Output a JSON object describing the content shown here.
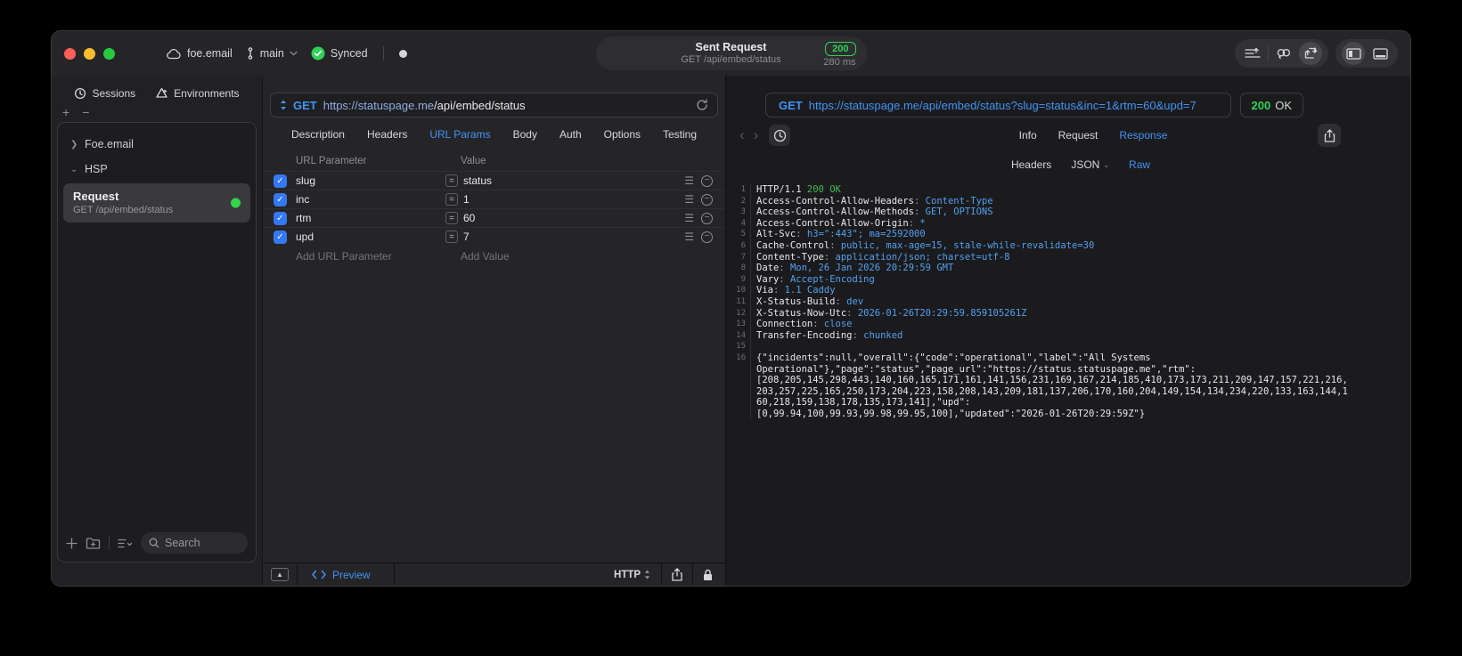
{
  "colors": {
    "accent_blue": "#4293f5",
    "status_green": "#30d158",
    "header_value_blue": "#52a0f0"
  },
  "titlebar": {
    "project": "foe.email",
    "branch": "main",
    "sync_label": "Synced",
    "center": {
      "title": "Sent Request",
      "subtitle": "GET /api/embed/status",
      "status_code": "200",
      "duration": "280 ms"
    }
  },
  "sidebar": {
    "tabs": [
      {
        "label": "Sessions"
      },
      {
        "label": "Environments"
      }
    ],
    "groups": [
      {
        "label": "Foe.email"
      },
      {
        "label": "HSP"
      }
    ],
    "request": {
      "title": "Request",
      "subtitle": "GET /api/embed/status"
    },
    "search_placeholder": "Search"
  },
  "request_pane": {
    "method": "GET",
    "url_host": "https://statuspage.me",
    "url_path": "/api/embed/status",
    "tabs": [
      "Description",
      "Headers",
      "URL Params",
      "Body",
      "Auth",
      "Options",
      "Testing"
    ],
    "active_tab": "URL Params",
    "params": {
      "columns": [
        "URL Parameter",
        "Value"
      ],
      "rows": [
        {
          "enabled": true,
          "name": "slug",
          "operator": "=",
          "value": "status"
        },
        {
          "enabled": true,
          "name": "inc",
          "operator": "=",
          "value": "1"
        },
        {
          "enabled": true,
          "name": "rtm",
          "operator": "=",
          "value": "60"
        },
        {
          "enabled": true,
          "name": "upd",
          "operator": "=",
          "value": "7"
        }
      ],
      "add_name_placeholder": "Add URL Parameter",
      "add_value_placeholder": "Add Value"
    },
    "footer": {
      "preview_label": "Preview",
      "protocol": "HTTP"
    }
  },
  "response_pane": {
    "method": "GET",
    "url": "https://statuspage.me/api/embed/status?slug=status&inc=1&rtm=60&upd=7",
    "status_code": "200",
    "status_text": "OK",
    "tabs": [
      "Info",
      "Request",
      "Response"
    ],
    "active_tab": "Response",
    "subtabs": [
      "Headers",
      "JSON",
      "Raw"
    ],
    "active_subtab": "Raw",
    "code": {
      "status_line": {
        "left": "HTTP/1.1 ",
        "right": "200 OK"
      },
      "headers": [
        {
          "name": "Access-Control-Allow-Headers",
          "value": "Content-Type"
        },
        {
          "name": "Access-Control-Allow-Methods",
          "value": "GET, OPTIONS"
        },
        {
          "name": "Access-Control-Allow-Origin",
          "value": "*"
        },
        {
          "name": "Alt-Svc",
          "value": "h3=\":443\"; ma=2592000"
        },
        {
          "name": "Cache-Control",
          "value": "public, max-age=15, stale-while-revalidate=30"
        },
        {
          "name": "Content-Type",
          "value": "application/json; charset=utf-8"
        },
        {
          "name": "Date",
          "value": "Mon, 26 Jan 2026 20:29:59 GMT"
        },
        {
          "name": "Vary",
          "value": "Accept-Encoding"
        },
        {
          "name": "Via",
          "value": "1.1 Caddy"
        },
        {
          "name": "X-Status-Build",
          "value": "dev"
        },
        {
          "name": "X-Status-Now-Utc",
          "value": "2026-01-26T20:29:59.859105261Z"
        },
        {
          "name": "Connection",
          "value": "close"
        },
        {
          "name": "Transfer-Encoding",
          "value": "chunked"
        }
      ],
      "body_lines": [
        "{\"incidents\":null,\"overall\":{\"code\":\"operational\",\"label\":\"All Systems",
        "Operational\"},\"page\":\"status\",\"page_url\":\"https://status.statuspage.me\",\"rtm\":",
        "[208,205,145,298,443,140,160,165,171,161,141,156,231,169,167,214,185,410,173,173,211,209,147,157,221,216,",
        "203,257,225,165,250,173,204,223,158,208,143,209,181,137,206,170,160,204,149,154,134,234,220,133,163,144,1",
        "60,218,159,138,178,135,173,141],\"upd\":",
        "[0,99.94,100,99.93,99.98,99.95,100],\"updated\":\"2026-01-26T20:29:59Z\"}"
      ]
    }
  }
}
